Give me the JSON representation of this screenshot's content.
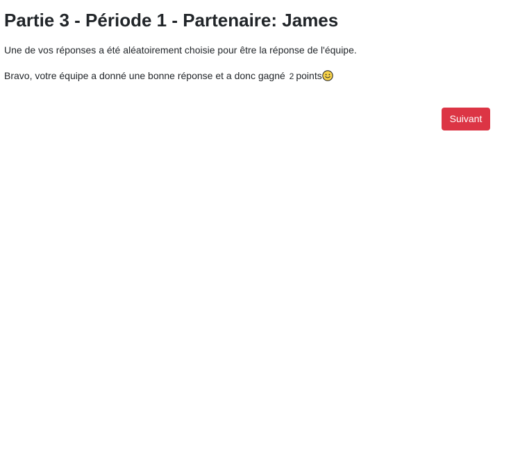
{
  "header": {
    "title": "Partie 3 - Période 1 - Partenaire: James"
  },
  "content": {
    "message_1": "Une de vos réponses a été aléatoirement choisie pour être la réponse de l'équipe.",
    "message_2_prefix": "Bravo, votre équipe a donné une bonne réponse et a donc gagné",
    "points_value": "2",
    "message_2_suffix": "points",
    "emoji_icon": "smiley-face-icon"
  },
  "actions": {
    "next_label": "Suivant",
    "next_color": "#dc3545"
  }
}
